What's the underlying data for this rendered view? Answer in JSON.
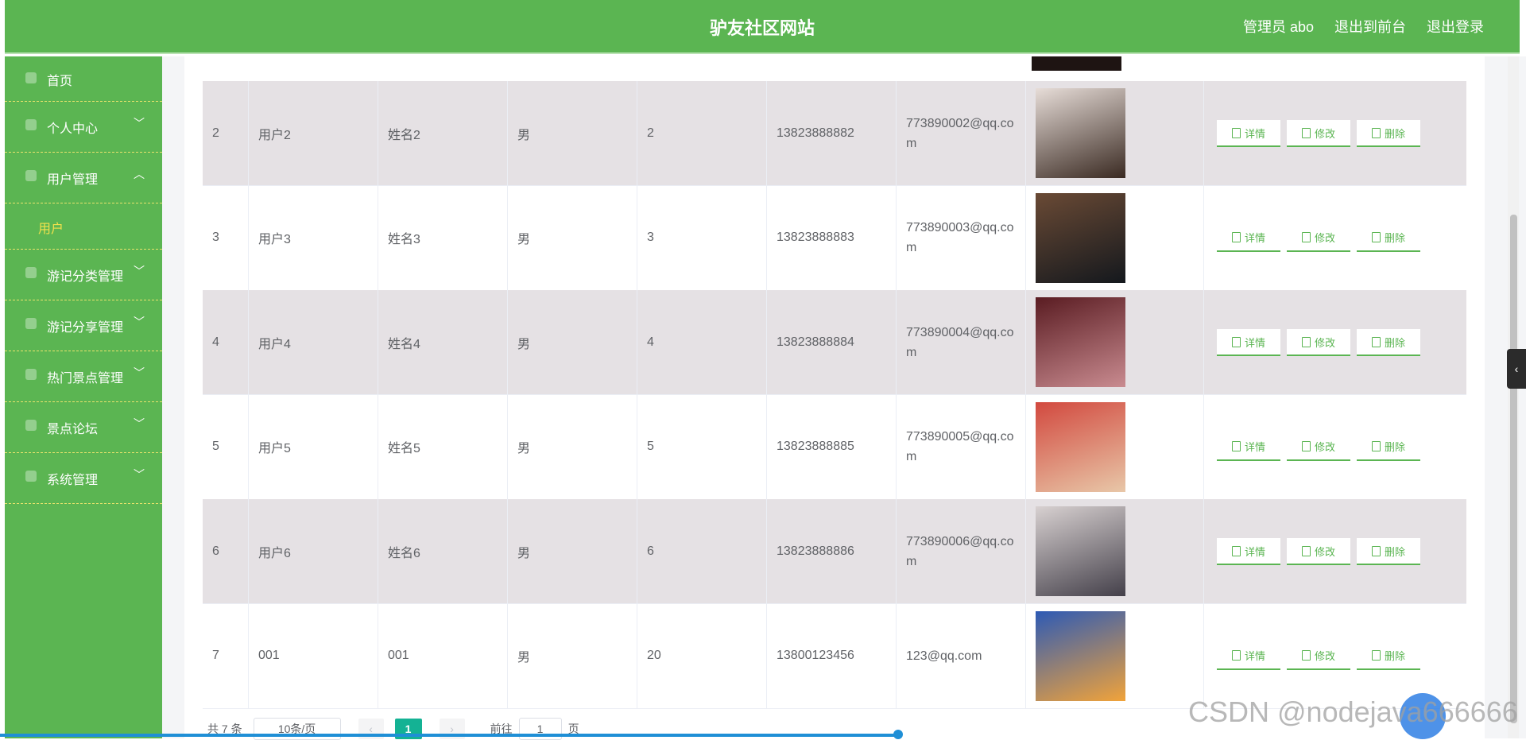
{
  "header": {
    "title": "驴友社区网站",
    "nav": [
      "管理员 abo",
      "退出到前台",
      "退出登录"
    ]
  },
  "sidebar": {
    "items": [
      {
        "label": "首页",
        "icon": "home-icon",
        "arrow": ""
      },
      {
        "label": "个人中心",
        "icon": "person-icon",
        "arrow": "﹀"
      },
      {
        "label": "用户管理",
        "icon": "users-icon",
        "arrow": "︿"
      },
      {
        "label": "用户",
        "icon": "",
        "arrow": ""
      },
      {
        "label": "游记分类管理",
        "icon": "category-icon",
        "arrow": "﹀"
      },
      {
        "label": "游记分享管理",
        "icon": "share-icon",
        "arrow": "﹀"
      },
      {
        "label": "热门景点管理",
        "icon": "location-icon",
        "arrow": "﹀"
      },
      {
        "label": "景点论坛",
        "icon": "forum-icon",
        "arrow": "﹀"
      },
      {
        "label": "系统管理",
        "icon": "settings-icon",
        "arrow": "﹀"
      }
    ]
  },
  "table": {
    "rows": [
      {
        "index": "2",
        "username": "用户2",
        "name": "姓名2",
        "gender": "男",
        "age": "2",
        "phone": "13823888882",
        "email": "773890002@qq.com",
        "photo_colors": [
          "#e7ddd8",
          "#3a2a22"
        ]
      },
      {
        "index": "3",
        "username": "用户3",
        "name": "姓名3",
        "gender": "男",
        "age": "3",
        "phone": "13823888883",
        "email": "773890003@qq.com",
        "photo_colors": [
          "#6a4a35",
          "#14181d"
        ]
      },
      {
        "index": "4",
        "username": "用户4",
        "name": "姓名4",
        "gender": "男",
        "age": "4",
        "phone": "13823888884",
        "email": "773890004@qq.com",
        "photo_colors": [
          "#5a1c22",
          "#c98b90"
        ]
      },
      {
        "index": "5",
        "username": "用户5",
        "name": "姓名5",
        "gender": "男",
        "age": "5",
        "phone": "13823888885",
        "email": "773890005@qq.com",
        "photo_colors": [
          "#d2493f",
          "#e8c7a8"
        ]
      },
      {
        "index": "6",
        "username": "用户6",
        "name": "姓名6",
        "gender": "男",
        "age": "6",
        "phone": "13823888886",
        "email": "773890006@qq.com",
        "photo_colors": [
          "#d8d1d1",
          "#44404a"
        ]
      },
      {
        "index": "7",
        "username": "001",
        "name": "001",
        "gender": "男",
        "age": "20",
        "phone": "13800123456",
        "email": "123@qq.com",
        "photo_colors": [
          "#2d5ab5",
          "#f1a33a"
        ]
      }
    ],
    "actions": {
      "detail": "详情",
      "edit": "修改",
      "delete": "删除"
    }
  },
  "pagination": {
    "total": "共 7 条",
    "page_size": "10条/页",
    "prev": "‹",
    "current": "1",
    "next": "›",
    "goto_prefix": "前往",
    "goto_value": "1",
    "goto_suffix": "页"
  },
  "watermark": "CSDN @nodejava666666",
  "colors": {
    "header": "#5bb552",
    "accent": "#5bb552",
    "alt_row": "#e5e1e4",
    "page_active": "#14b294"
  }
}
